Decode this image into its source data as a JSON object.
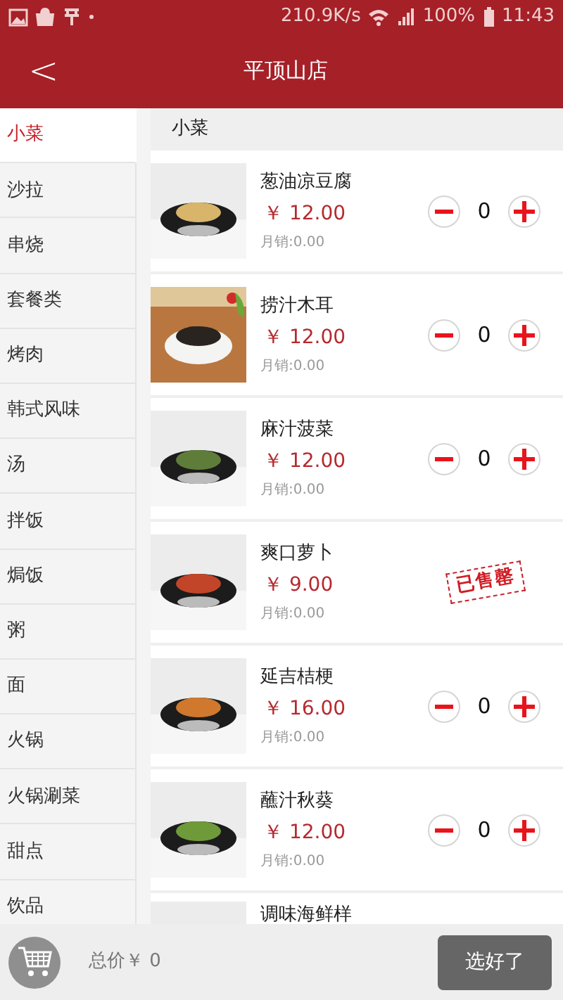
{
  "status_bar": {
    "speed": "210.9K/s",
    "battery": "100%",
    "time": "11:43"
  },
  "header": {
    "back": "<",
    "title": "平顶山店"
  },
  "categories": [
    {
      "label": "小菜",
      "selected": true
    },
    {
      "label": "沙拉",
      "selected": false
    },
    {
      "label": "串烧",
      "selected": false
    },
    {
      "label": "套餐类",
      "selected": false
    },
    {
      "label": "烤肉",
      "selected": false
    },
    {
      "label": "韩式风味",
      "selected": false
    },
    {
      "label": "汤",
      "selected": false
    },
    {
      "label": "拌饭",
      "selected": false
    },
    {
      "label": "焗饭",
      "selected": false
    },
    {
      "label": "粥",
      "selected": false
    },
    {
      "label": "面",
      "selected": false
    },
    {
      "label": "火锅",
      "selected": false
    },
    {
      "label": "火锅涮菜",
      "selected": false
    },
    {
      "label": "甜点",
      "selected": false
    },
    {
      "label": "饮品",
      "selected": false
    }
  ],
  "section_title": "小菜",
  "dishes": [
    {
      "kind": "stepper",
      "name": "葱油凉豆腐",
      "price": "￥ 12.00",
      "sales": "月销:0.00",
      "count": "0"
    },
    {
      "kind": "stepper",
      "name": "捞汁木耳",
      "price": "￥ 12.00",
      "sales": "月销:0.00",
      "count": "0"
    },
    {
      "kind": "stepper",
      "name": "麻汁菠菜",
      "price": "￥ 12.00",
      "sales": "月销:0.00",
      "count": "0"
    },
    {
      "kind": "sold_out",
      "name": "爽口萝卜",
      "price": "￥ 9.00",
      "sales": "月销:0.00",
      "stamp": "已售罄"
    },
    {
      "kind": "stepper",
      "name": "延吉桔梗",
      "price": "￥ 16.00",
      "sales": "月销:0.00",
      "count": "0"
    },
    {
      "kind": "stepper",
      "name": "蘸汁秋葵",
      "price": "￥ 12.00",
      "sales": "月销:0.00",
      "count": "0"
    },
    {
      "kind": "cut_off",
      "name": "调味海鲜样"
    }
  ],
  "footer": {
    "total": "总价￥ 0",
    "button": "选好了"
  }
}
